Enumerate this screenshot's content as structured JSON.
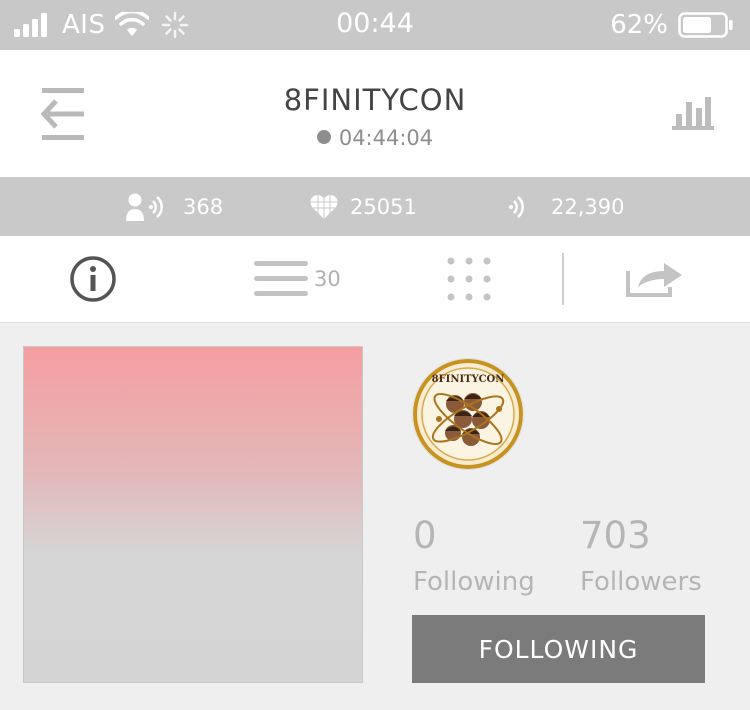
{
  "status_bar": {
    "carrier": "AIS",
    "time": "00:44",
    "battery": "62%",
    "icons": [
      "signal-icon",
      "wifi-icon",
      "activity-spinner-icon",
      "battery-icon"
    ]
  },
  "header": {
    "title": "8FINITYCON",
    "live_duration": "04:44:04",
    "icons": [
      "back-arrow-icon",
      "bar-chart-icon"
    ]
  },
  "stats": {
    "viewers": "368",
    "hearts": "25051",
    "broadcasts": "22,390",
    "icons": [
      "viewer-icon",
      "heart-icon",
      "broadcast-icon"
    ]
  },
  "tabs": {
    "list_count": "30",
    "icons": [
      "info-icon",
      "list-icon",
      "grid-icon",
      "share-icon"
    ]
  },
  "profile": {
    "avatar_text": "8FINITYCON",
    "following_count": "0",
    "following_label": "Following",
    "followers_count": "703",
    "followers_label": "Followers",
    "follow_button": "FOLLOWING"
  },
  "colors": {
    "status_bar_bg": "#c8c8c8",
    "stats_bar_bg": "#c9c9c9",
    "button_bg": "#7b7b7b",
    "cover_top": "#f59ea1"
  }
}
